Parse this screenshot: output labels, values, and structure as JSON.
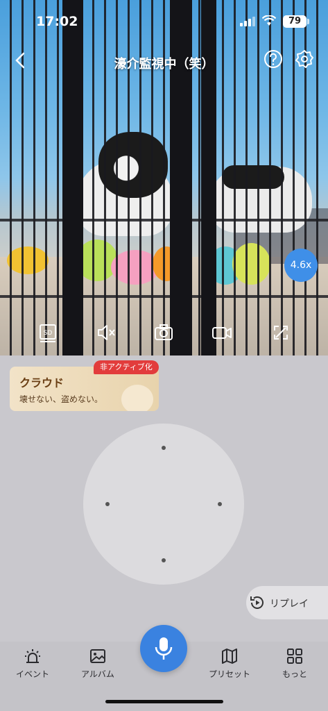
{
  "status": {
    "time": "17:02",
    "battery": "79"
  },
  "nav": {
    "title": "濠介監視中（笑）",
    "back_icon": "chevron-left-icon",
    "help_icon": "question-icon",
    "settings_icon": "gear-icon"
  },
  "feed": {
    "zoom": "4.6x",
    "tools": [
      "sd-card-icon",
      "mute-icon",
      "camera-icon",
      "video-icon",
      "fullscreen-icon"
    ]
  },
  "cloud": {
    "title": "クラウド",
    "subtitle": "壊せない、盗めない。",
    "badge": "非アクティブ化"
  },
  "replay": {
    "label": "リプレイ"
  },
  "tabs": [
    {
      "label": "イベント",
      "icon": "alarm-icon"
    },
    {
      "label": "アルバム",
      "icon": "image-icon"
    },
    {
      "label": "プリセット",
      "icon": "map-icon"
    },
    {
      "label": "もっと",
      "icon": "grid-icon"
    }
  ],
  "colors": {
    "accent": "#3a82e0",
    "badge": "#e23c3c",
    "cloud_text": "#6a3e14"
  }
}
